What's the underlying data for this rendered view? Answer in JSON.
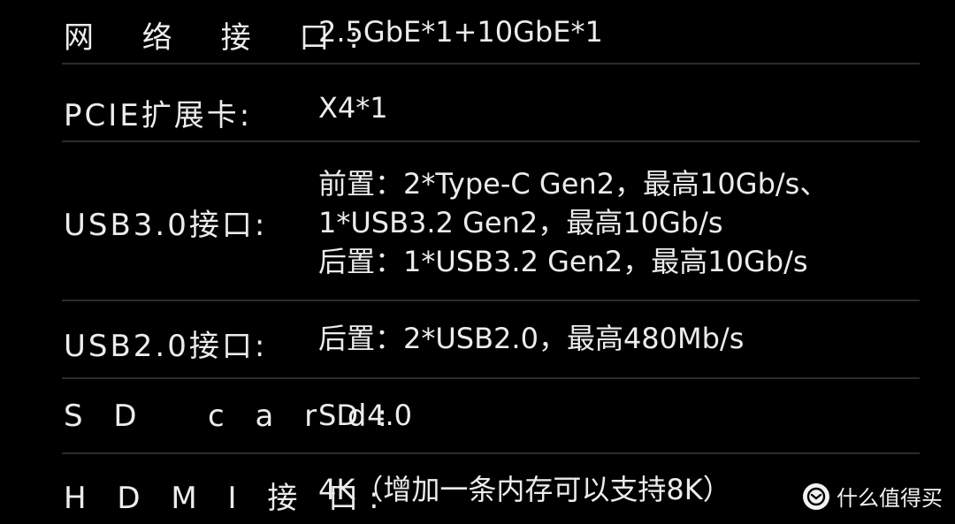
{
  "rows": [
    {
      "label": "网 络 接 口:",
      "values": [
        "2.5GbE*1+10GbE*1"
      ]
    },
    {
      "label": "PCIE扩展卡:",
      "values": [
        "X4*1"
      ]
    },
    {
      "label": "USB3.0接口:",
      "values": [
        "前置：2*Type-C Gen2，最高10Gb/s、",
        "1*USB3.2 Gen2，最高10Gb/s",
        "后置：1*USB3.2 Gen2，最高10Gb/s"
      ]
    },
    {
      "label": "USB2.0接口:",
      "values": [
        "后置：2*USB2.0，最高480Mb/s"
      ]
    },
    {
      "label": "S D   c a r d:",
      "values": [
        "SD 4.0"
      ]
    },
    {
      "label": "H D M I 接 口:",
      "values": [
        "4K（增加一条内存可以支持8K）"
      ]
    }
  ],
  "watermark": {
    "icon": "zhidemai-logo-icon",
    "text": "什么值得买"
  }
}
